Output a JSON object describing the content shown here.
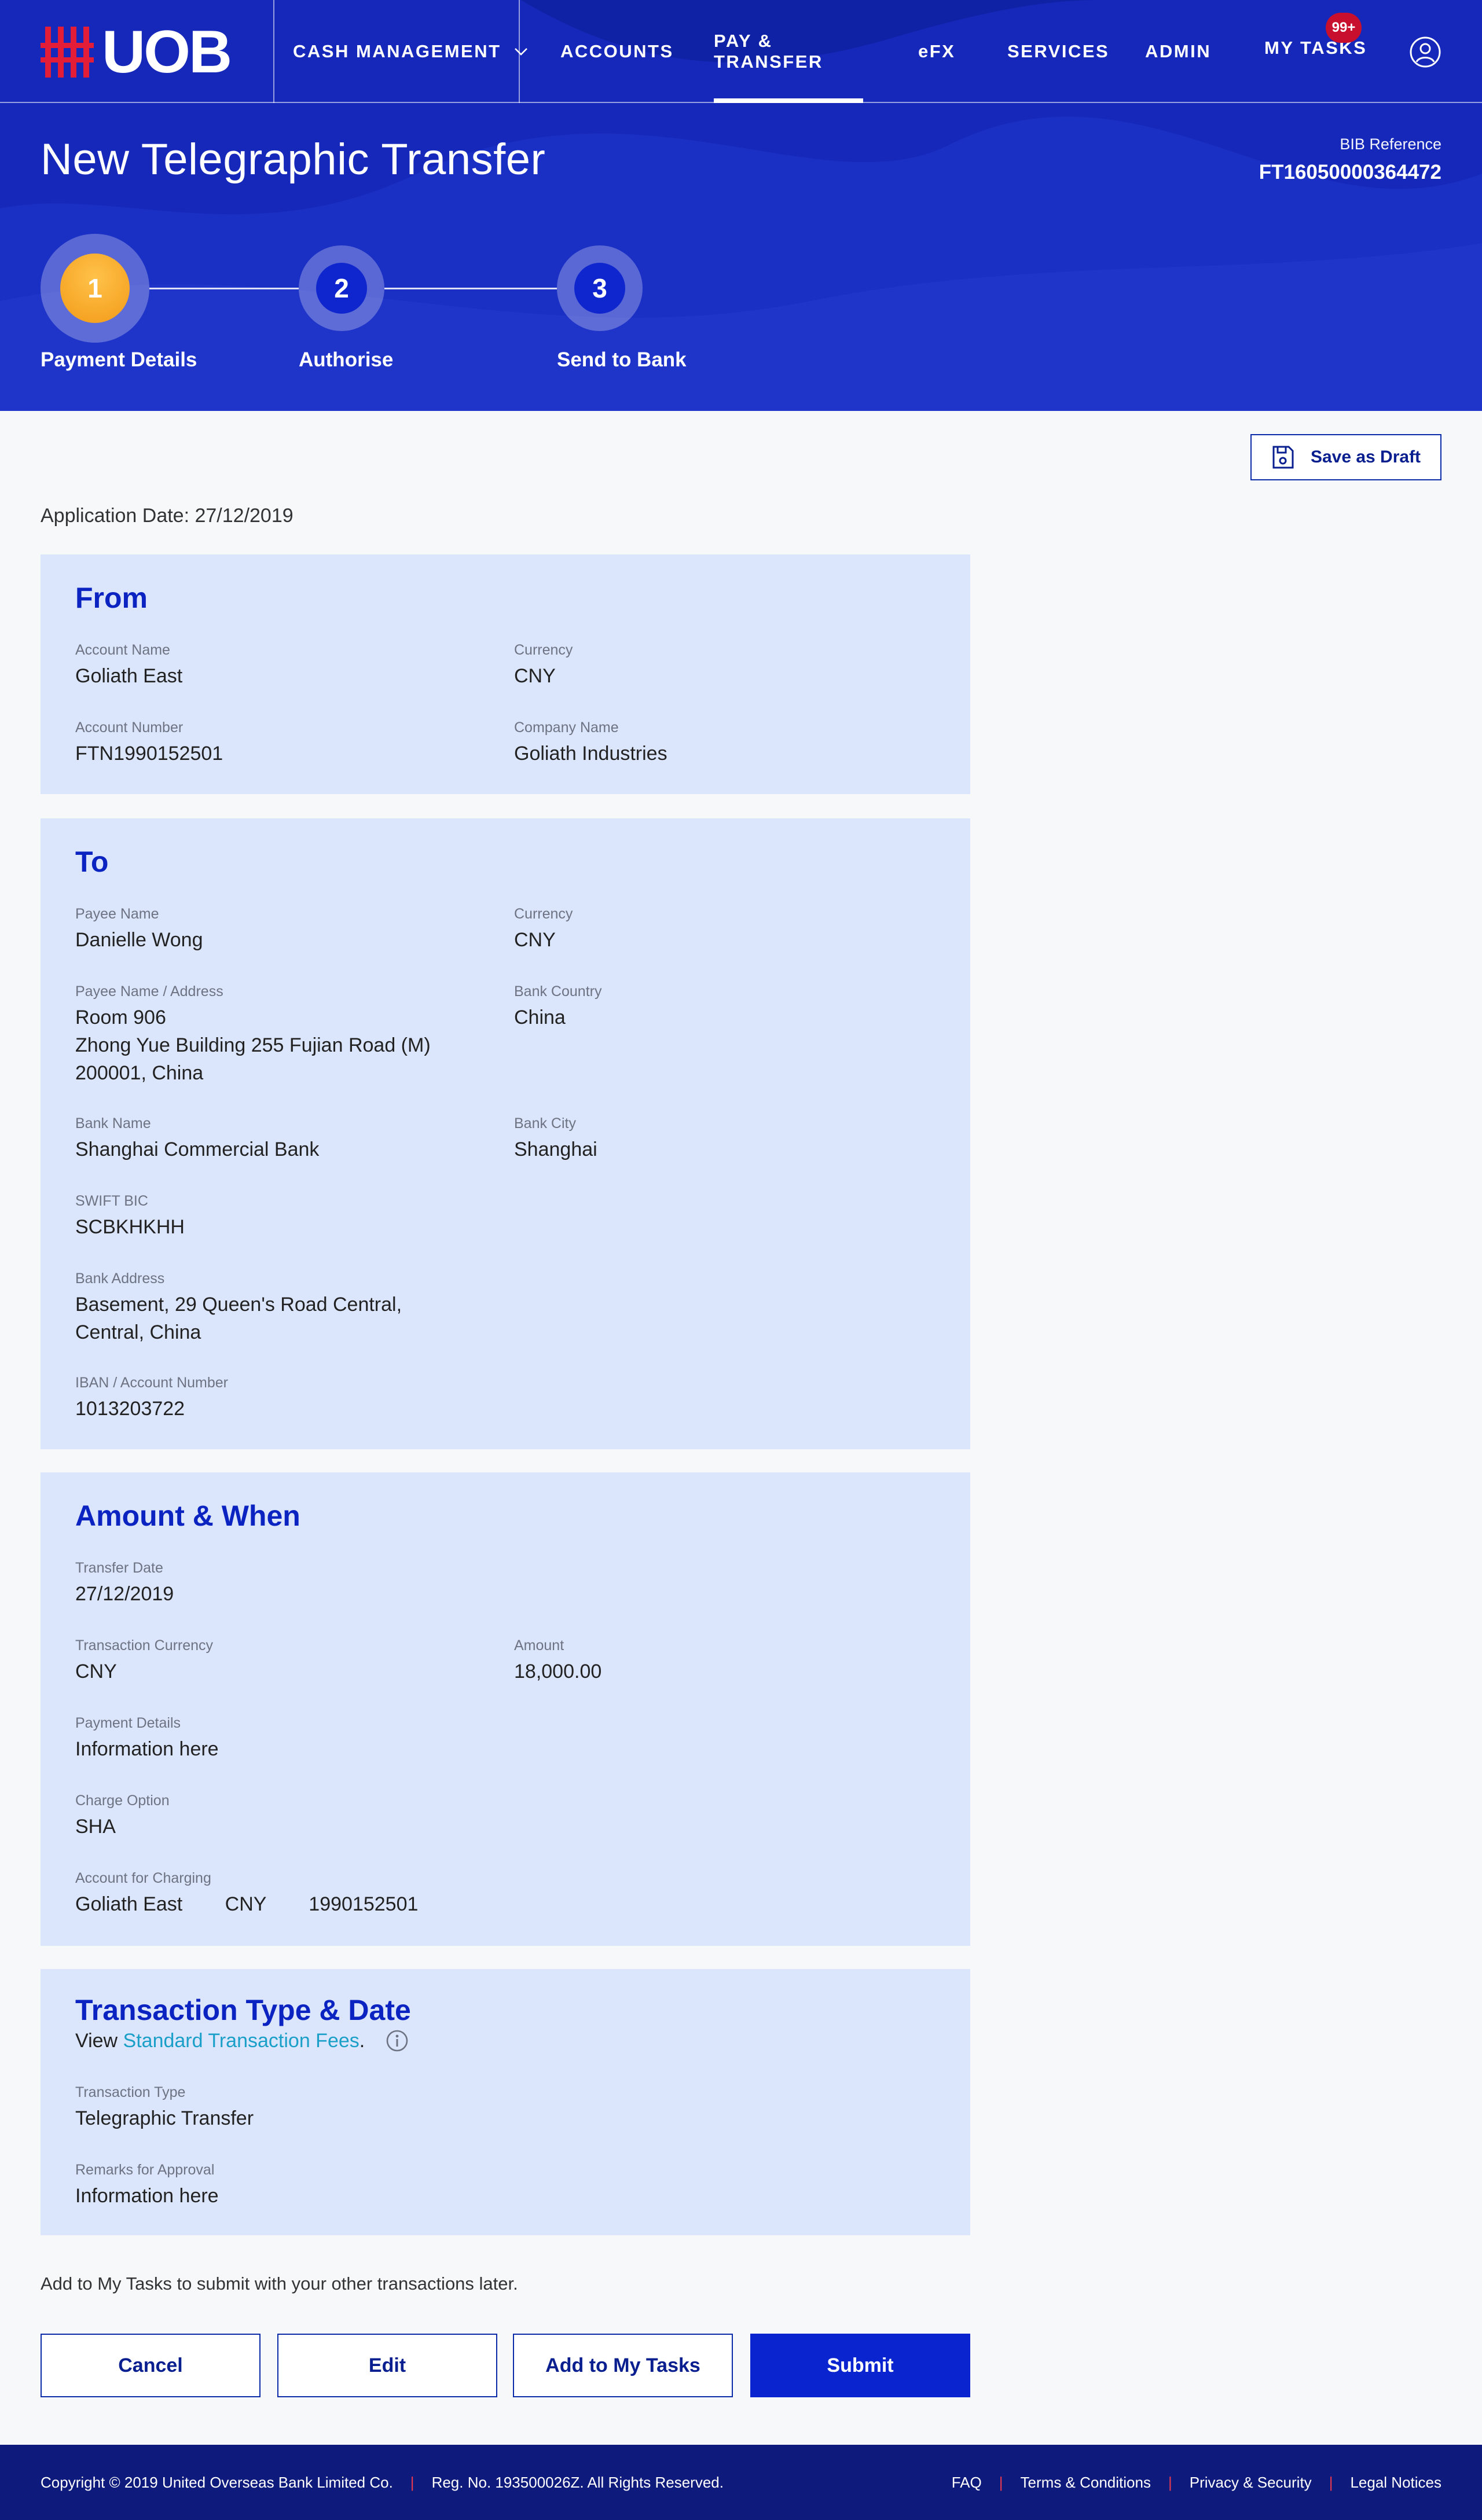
{
  "brand": {
    "name": "UOB",
    "logo_color": "#e31d38"
  },
  "nav": {
    "cash_management": "CASH MANAGEMENT",
    "accounts": "ACCOUNTS",
    "pay_transfer": "PAY & TRANSFER",
    "efx": "eFX",
    "services": "SERVICES",
    "admin": "ADMIN",
    "my_tasks": "MY TASKS",
    "my_tasks_badge": "99+",
    "active": "PAY & TRANSFER"
  },
  "page": {
    "title": "New Telegraphic Transfer",
    "bib_label": "BIB Reference",
    "bib_value": "FT16050000364472"
  },
  "steps": [
    {
      "number": "1",
      "label": "Payment Details",
      "state": "current"
    },
    {
      "number": "2",
      "label": "Authorise",
      "state": "pending"
    },
    {
      "number": "3",
      "label": "Send to Bank",
      "state": "pending"
    }
  ],
  "actions": {
    "save_draft": "Save as Draft"
  },
  "application_date": "Application Date: 27/12/2019",
  "from": {
    "title": "From",
    "account_name_label": "Account Name",
    "account_name": "Goliath East",
    "currency_label": "Currency",
    "currency": "CNY",
    "account_number_label": "Account Number",
    "account_number": "FTN1990152501",
    "company_name_label": "Company Name",
    "company_name": "Goliath Industries"
  },
  "to": {
    "title": "To",
    "payee_name_label": "Payee Name",
    "payee_name": "Danielle Wong",
    "currency_label": "Currency",
    "currency": "CNY",
    "payee_address_label": "Payee Name / Address",
    "payee_address_1": "Room 906",
    "payee_address_2": "Zhong Yue Building 255 Fujian Road (M)",
    "payee_address_3": "200001, China",
    "bank_country_label": "Bank Country",
    "bank_country": "China",
    "bank_name_label": "Bank Name",
    "bank_name": "Shanghai Commercial Bank",
    "bank_city_label": "Bank City",
    "bank_city": "Shanghai",
    "swift_label": "SWIFT BIC",
    "swift": "SCBKHKHH",
    "bank_address_label": "Bank Address",
    "bank_address_1": "Basement, 29 Queen's Road Central,",
    "bank_address_2": "Central, China",
    "iban_label": "IBAN / Account Number",
    "iban": "1013203722"
  },
  "amount": {
    "title": "Amount & When",
    "transfer_date_label": "Transfer Date",
    "transfer_date": "27/12/2019",
    "txn_currency_label": "Transaction Currency",
    "txn_currency": "CNY",
    "amount_label": "Amount",
    "amount": "18,000.00",
    "payment_details_label": "Payment Details",
    "payment_details": "Information here",
    "charge_option_label": "Charge Option",
    "charge_option": "SHA",
    "charging_account_label": "Account for Charging",
    "charging_account_name": "Goliath East",
    "charging_account_currency": "CNY",
    "charging_account_number": "1990152501"
  },
  "transaction": {
    "title": "Transaction Type & Date",
    "fees_prefix": "View ",
    "fees_link": "Standard Transaction Fees",
    "fees_suffix": ".",
    "type_label": "Transaction Type",
    "type": "Telegraphic Transfer",
    "remarks_label": "Remarks for Approval",
    "remarks": "Information here"
  },
  "note": "Add to My Tasks to submit with your other transactions later.",
  "buttons": {
    "cancel": "Cancel",
    "edit": "Edit",
    "add_tasks": "Add to My Tasks",
    "submit": "Submit"
  },
  "footer": {
    "copyright": "Copyright © 2019 United Overseas Bank Limited Co.",
    "reg": "Reg. No. 193500026Z. All Rights Reserved.",
    "faq": "FAQ",
    "terms": "Terms & Conditions",
    "privacy": "Privacy & Security",
    "legal": "Legal Notices"
  },
  "colors": {
    "primary": "#0a24d0",
    "header": "#1a2fc4",
    "card": "#dbe6fd",
    "step_current": "#f7a823",
    "badge": "#c8102e",
    "link": "#1a9fc8",
    "footer": "#0e1b7c"
  },
  "icons": [
    "uob-logo",
    "chevron-down-icon",
    "user-icon",
    "save-icon",
    "info-icon"
  ]
}
